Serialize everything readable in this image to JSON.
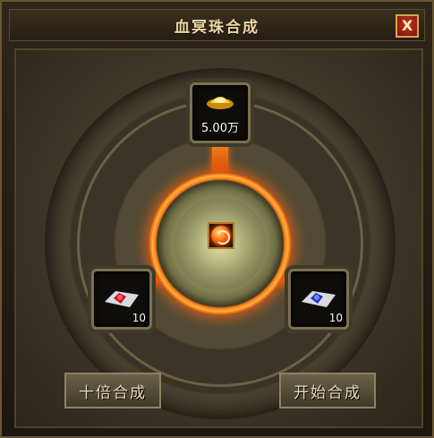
{
  "window": {
    "title": "血冥珠合成",
    "close_label": "X"
  },
  "slots": {
    "gold": {
      "amount": "5.00万",
      "icon": "gold-ingot-icon"
    },
    "red_gem": {
      "count": "10",
      "icon": "red-gem-icon"
    },
    "blue_gem": {
      "count": "10",
      "icon": "blue-gem-icon"
    }
  },
  "result": {
    "icon": "blood-orb-icon"
  },
  "buttons": {
    "ten_times": "十倍合成",
    "start": "开始合成"
  },
  "colors": {
    "fire": "#ff7a18",
    "gold_border": "#d7a84b",
    "title_text": "#e9d6a3"
  }
}
